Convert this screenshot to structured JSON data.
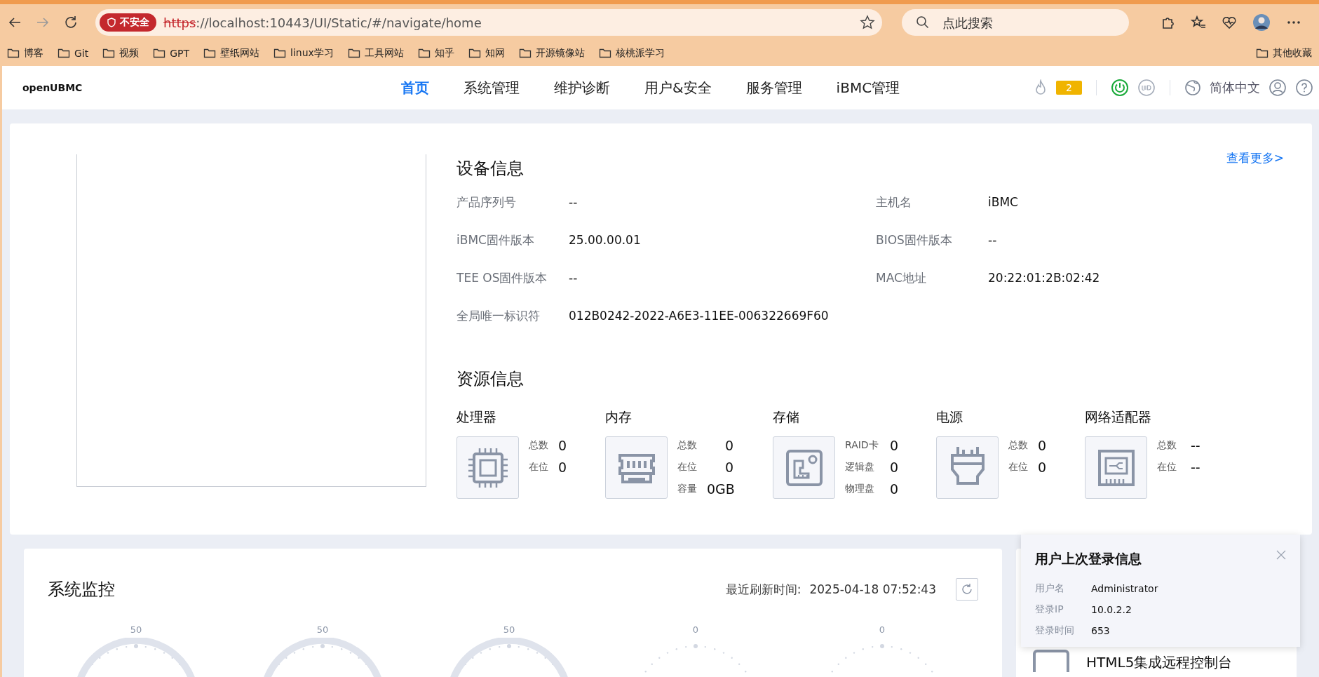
{
  "browser": {
    "security_badge": "不安全",
    "url_scheme": "https",
    "url_rest": "://localhost:10443/UI/Static/#/navigate/home",
    "search_placeholder": "点此搜索",
    "bookmarks": [
      "博客",
      "Git",
      "视频",
      "GPT",
      "壁纸网站",
      "linux学习",
      "工具网站",
      "知乎",
      "知网",
      "开源镜像站",
      "核桃派学习"
    ],
    "other_bookmarks": "其他收藏"
  },
  "header": {
    "logo": "openUBMC",
    "nav": [
      {
        "label": "首页",
        "selected": true
      },
      {
        "label": "系统管理",
        "selected": false
      },
      {
        "label": "维护诊断",
        "selected": false
      },
      {
        "label": "用户&安全",
        "selected": false
      },
      {
        "label": "服务管理",
        "selected": false
      },
      {
        "label": "iBMC管理",
        "selected": false
      }
    ],
    "alarm_count": "2",
    "language": "简体中文"
  },
  "device_info": {
    "title": "设备信息",
    "more_link": "查看更多>",
    "fields": [
      {
        "label": "产品序列号",
        "value": "--"
      },
      {
        "label": "主机名",
        "value": "iBMC"
      },
      {
        "label": "iBMC固件版本",
        "value": "25.00.00.01"
      },
      {
        "label": "BIOS固件版本",
        "value": "--"
      },
      {
        "label": "TEE OS固件版本",
        "value": "--"
      },
      {
        "label": "MAC地址",
        "value": "20:22:01:2B:02:42"
      },
      {
        "label": "全局唯一标识符",
        "value": "012B0242-2022-A6E3-11EE-006322669F60"
      }
    ]
  },
  "resource_info": {
    "title": "资源信息",
    "items": [
      {
        "name": "处理器",
        "kind": "cpu",
        "stats": [
          {
            "label": "总数",
            "value": "0"
          },
          {
            "label": "在位",
            "value": "0"
          }
        ]
      },
      {
        "name": "内存",
        "kind": "memory",
        "stats": [
          {
            "label": "总数",
            "value": "0"
          },
          {
            "label": "在位",
            "value": "0"
          },
          {
            "label": "容量",
            "value": "0GB"
          }
        ]
      },
      {
        "name": "存储",
        "kind": "storage",
        "stats": [
          {
            "label": "RAID卡",
            "value": "0"
          },
          {
            "label": "逻辑盘",
            "value": "0"
          },
          {
            "label": "物理盘",
            "value": "0"
          }
        ]
      },
      {
        "name": "电源",
        "kind": "power",
        "stats": [
          {
            "label": "总数",
            "value": "0"
          },
          {
            "label": "在位",
            "value": "0"
          }
        ]
      },
      {
        "name": "网络适配器",
        "kind": "network",
        "stats": [
          {
            "label": "总数",
            "value": "--"
          },
          {
            "label": "在位",
            "value": "--"
          }
        ]
      }
    ]
  },
  "system_monitor": {
    "title": "系统监控",
    "refresh_label": "最近刷新时间:",
    "refresh_time": "2025-04-18 07:52:43",
    "gauges": [
      {
        "threshold": "50"
      },
      {
        "threshold": "50"
      },
      {
        "threshold": "50"
      },
      {
        "threshold": "0"
      },
      {
        "threshold": "0"
      }
    ]
  },
  "remote_console": {
    "title": "HTML5集成远程控制台"
  },
  "login_popup": {
    "title": "用户上次登录信息",
    "fields": [
      {
        "label": "用户名",
        "value": "Administrator"
      },
      {
        "label": "登录IP",
        "value": "10.0.2.2"
      },
      {
        "label": "登录时间",
        "value": "653"
      }
    ]
  }
}
